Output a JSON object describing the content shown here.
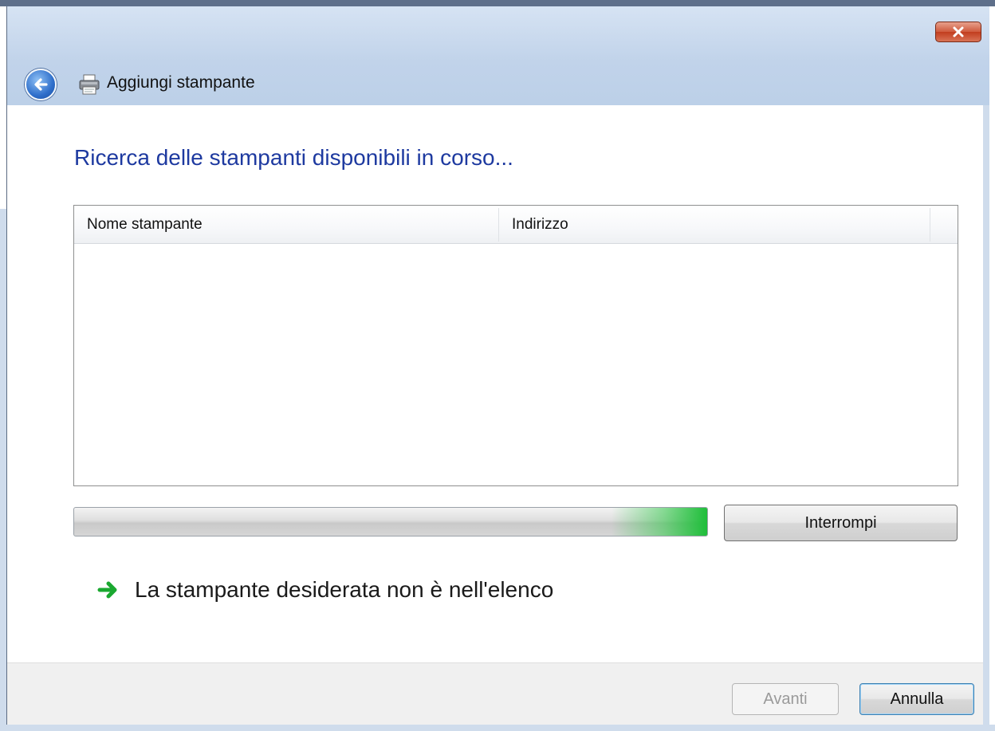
{
  "window": {
    "title": "Aggiungi stampante",
    "close_label": "x"
  },
  "main": {
    "heading": "Ricerca delle stampanti disponibili in corso..."
  },
  "printer_list": {
    "columns": [
      "Nome stampante",
      "Indirizzo"
    ],
    "rows": []
  },
  "progress": {
    "state": "searching",
    "accent_color": "#1fbe3a"
  },
  "actions": {
    "stop_label": "Interrompi",
    "missing_printer_link": "La stampante desiderata non è nell'elenco"
  },
  "footer": {
    "next_label": "Avanti",
    "next_enabled": false,
    "cancel_label": "Annulla"
  },
  "icons": {
    "back": "back-arrow-icon",
    "printer": "printer-icon",
    "close": "close-icon",
    "link_arrow": "green-arrow-icon"
  }
}
